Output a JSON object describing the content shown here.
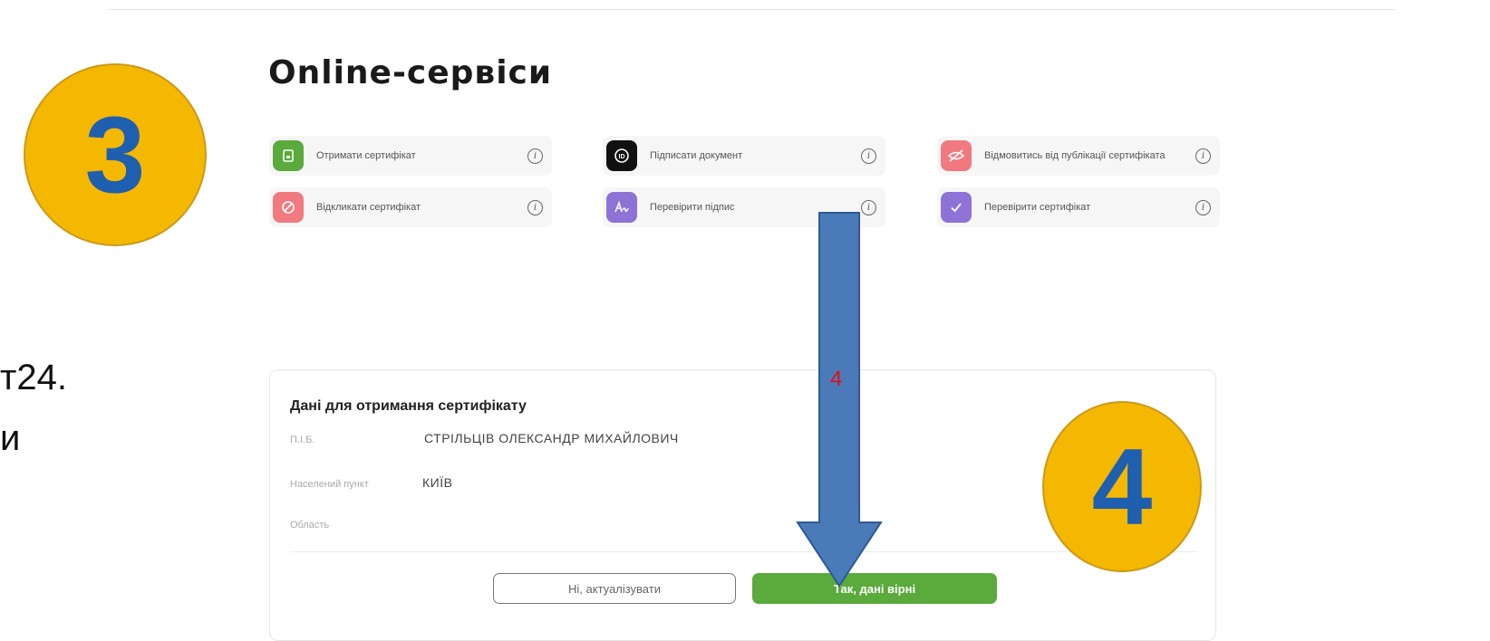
{
  "bubbles": {
    "step3": "3",
    "step4": "4"
  },
  "side_text": {
    "line1": "т24.",
    "line2": "и"
  },
  "page": {
    "title": "Online-сервіси"
  },
  "services": [
    {
      "label": "Отримати сертифікат",
      "icon": "certificate-icon",
      "color": "#5aaa3c"
    },
    {
      "label": "Підписати документ",
      "icon": "id-sign-icon",
      "color": "#111111"
    },
    {
      "label": "Відмовитись від публікації сертифіката",
      "icon": "hidden-eye-icon",
      "color": "#f07a80"
    },
    {
      "label": "Відкликати сертифікат",
      "icon": "revoke-icon",
      "color": "#f07a80"
    },
    {
      "label": "Перевірити підпис",
      "icon": "signature-icon",
      "color": "#8e72d6"
    },
    {
      "label": "Перевірити сертифікат",
      "icon": "check-icon",
      "color": "#8e72d6"
    }
  ],
  "card": {
    "title": "Дані для отримання сертифікату",
    "fields": [
      {
        "label": "П.І.Б.",
        "value": "СТРІЛЬЦІВ ОЛЕКСАНДР МИХАЙЛОВИЧ"
      },
      {
        "label": "Населений пункт",
        "value": "КИЇВ"
      },
      {
        "label": "Область",
        "value": ""
      }
    ],
    "buttons": {
      "reject": "Ні, актуалізувати",
      "confirm": "Так, дані вірні"
    }
  },
  "annotation": {
    "arrow_label": "4",
    "arrow_color": "#4a7ab8"
  }
}
